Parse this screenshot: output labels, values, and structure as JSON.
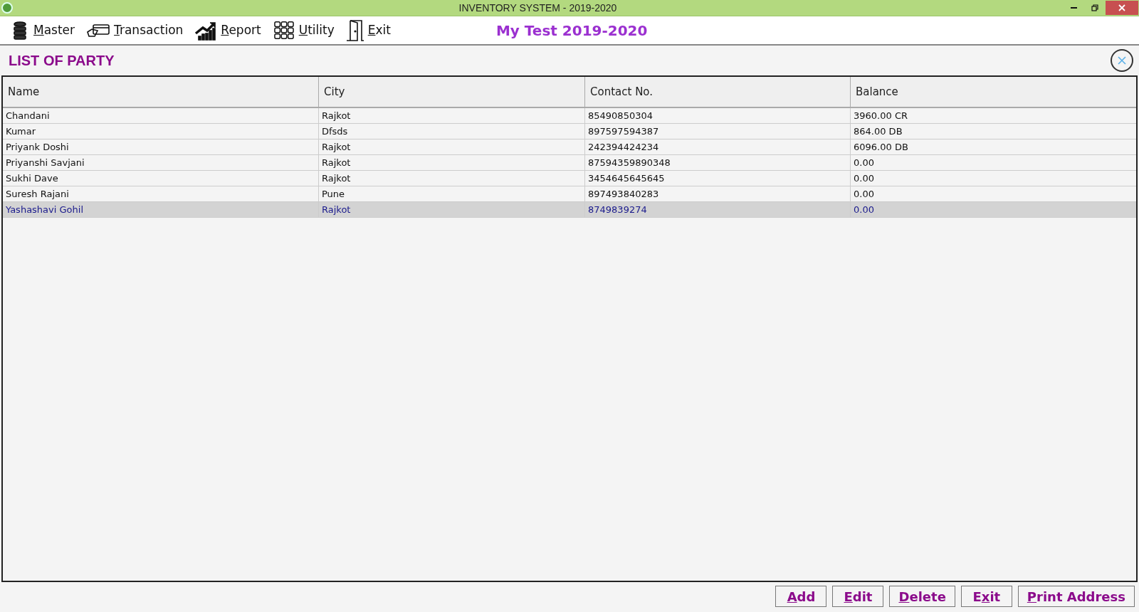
{
  "window": {
    "title": "INVENTORY SYSTEM - 2019-2020"
  },
  "menu": [
    {
      "kind": "database",
      "key": "M",
      "after": "aster"
    },
    {
      "kind": "card",
      "key": "T",
      "after": "ransaction"
    },
    {
      "kind": "chart",
      "key": "R",
      "after": "eport"
    },
    {
      "kind": "grid",
      "key": "U",
      "after": "tility"
    },
    {
      "kind": "door",
      "key": "E",
      "after": "xit"
    }
  ],
  "company": "My Test 2019-2020",
  "panel": {
    "title": "LIST OF PARTY"
  },
  "table": {
    "columns": [
      "Name",
      "City",
      "Contact No.",
      "Balance"
    ],
    "rows": [
      {
        "cells": [
          "Chandani",
          "Rajkot",
          "85490850304",
          "3960.00 CR"
        ],
        "selected": false
      },
      {
        "cells": [
          "Kumar",
          "Dfsds",
          "897597594387",
          "864.00 DB"
        ],
        "selected": false
      },
      {
        "cells": [
          "Priyank Doshi",
          "Rajkot",
          "242394424234",
          "6096.00 DB"
        ],
        "selected": false
      },
      {
        "cells": [
          "Priyanshi Savjani",
          "Rajkot",
          "87594359890348",
          "0.00"
        ],
        "selected": false
      },
      {
        "cells": [
          "Sukhi Dave",
          "Rajkot",
          "3454645645645",
          "0.00"
        ],
        "selected": false
      },
      {
        "cells": [
          "Suresh Rajani",
          "Pune",
          "897493840283",
          "0.00"
        ],
        "selected": false
      },
      {
        "cells": [
          "Yashashavi Gohil",
          "Rajkot",
          "8749839274",
          "0.00"
        ],
        "selected": true
      }
    ]
  },
  "buttons": [
    {
      "key": "A",
      "after": "dd"
    },
    {
      "key": "E",
      "after": "dit"
    },
    {
      "key": "D",
      "after": "elete"
    },
    {
      "before": "E",
      "key": "x",
      "after": "it"
    },
    {
      "key": "P",
      "after": "rint Address"
    }
  ]
}
